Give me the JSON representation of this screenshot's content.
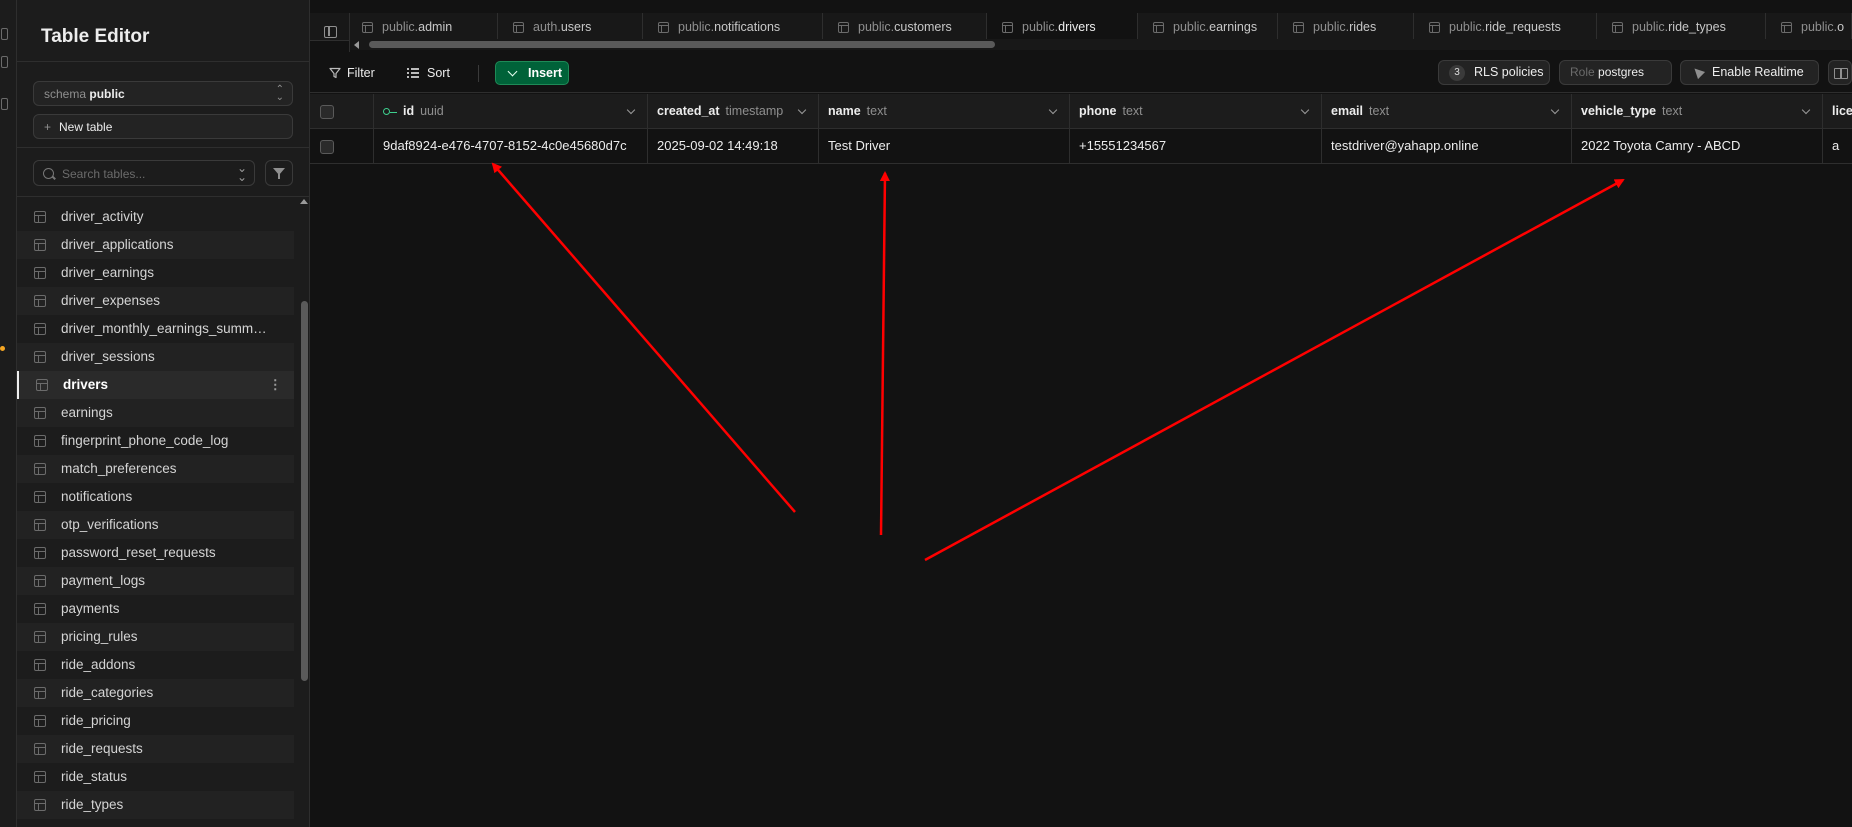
{
  "sidebar": {
    "title": "Table Editor",
    "schema_label": "schema",
    "schema_value": "public",
    "new_table_label": "New table",
    "search_placeholder": "Search tables...",
    "tables": [
      {
        "name": "driver_activity",
        "active": false
      },
      {
        "name": "driver_applications",
        "active": false
      },
      {
        "name": "driver_earnings",
        "active": false
      },
      {
        "name": "driver_expenses",
        "active": false
      },
      {
        "name": "driver_monthly_earnings_summ…",
        "active": false
      },
      {
        "name": "driver_sessions",
        "active": false
      },
      {
        "name": "drivers",
        "active": true
      },
      {
        "name": "earnings",
        "active": false
      },
      {
        "name": "fingerprint_phone_code_log",
        "active": false
      },
      {
        "name": "match_preferences",
        "active": false
      },
      {
        "name": "notifications",
        "active": false
      },
      {
        "name": "otp_verifications",
        "active": false
      },
      {
        "name": "password_reset_requests",
        "active": false
      },
      {
        "name": "payment_logs",
        "active": false
      },
      {
        "name": "payments",
        "active": false
      },
      {
        "name": "pricing_rules",
        "active": false
      },
      {
        "name": "ride_addons",
        "active": false
      },
      {
        "name": "ride_categories",
        "active": false
      },
      {
        "name": "ride_pricing",
        "active": false
      },
      {
        "name": "ride_requests",
        "active": false
      },
      {
        "name": "ride_status",
        "active": false
      },
      {
        "name": "ride_types",
        "active": false
      }
    ]
  },
  "tabs": [
    {
      "schema": "public.",
      "table": "admin",
      "active": false
    },
    {
      "schema": "auth.",
      "table": "users",
      "active": false
    },
    {
      "schema": "public.",
      "table": "notifications",
      "active": false
    },
    {
      "schema": "public.",
      "table": "customers",
      "active": false
    },
    {
      "schema": "public.",
      "table": "drivers",
      "active": true
    },
    {
      "schema": "public.",
      "table": "earnings",
      "active": false
    },
    {
      "schema": "public.",
      "table": "rides",
      "active": false
    },
    {
      "schema": "public.",
      "table": "ride_requests",
      "active": false
    },
    {
      "schema": "public.",
      "table": "ride_types",
      "active": false
    },
    {
      "schema": "public.",
      "table": "o",
      "active": false
    }
  ],
  "toolbar": {
    "filter_label": "Filter",
    "sort_label": "Sort",
    "insert_label": "Insert",
    "rls_count": "3",
    "rls_label": "RLS policies",
    "role_label": "Role",
    "role_value": "postgres",
    "realtime_label": "Enable Realtime"
  },
  "columns": [
    {
      "name": "id",
      "type": "uuid",
      "primary_key": true
    },
    {
      "name": "created_at",
      "type": "timestamp",
      "primary_key": false
    },
    {
      "name": "name",
      "type": "text",
      "primary_key": false
    },
    {
      "name": "phone",
      "type": "text",
      "primary_key": false
    },
    {
      "name": "email",
      "type": "text",
      "primary_key": false
    },
    {
      "name": "vehicle_type",
      "type": "text",
      "primary_key": false
    },
    {
      "name": "licer",
      "type": "",
      "primary_key": false
    }
  ],
  "rows": [
    [
      "9daf8924-e476-4707-8152-4c0e45680d7c",
      "2025-09-02 14:49:18",
      "Test Driver",
      "+15551234567",
      "testdriver@yahapp.online",
      "2022 Toyota Camry - ABCD",
      "a"
    ]
  ],
  "colors": {
    "background": "#121212",
    "sidebar": "#1c1c1c",
    "accent_green": "#006239",
    "key_green": "#3ecf8e",
    "annotation_red": "#ff0000"
  }
}
